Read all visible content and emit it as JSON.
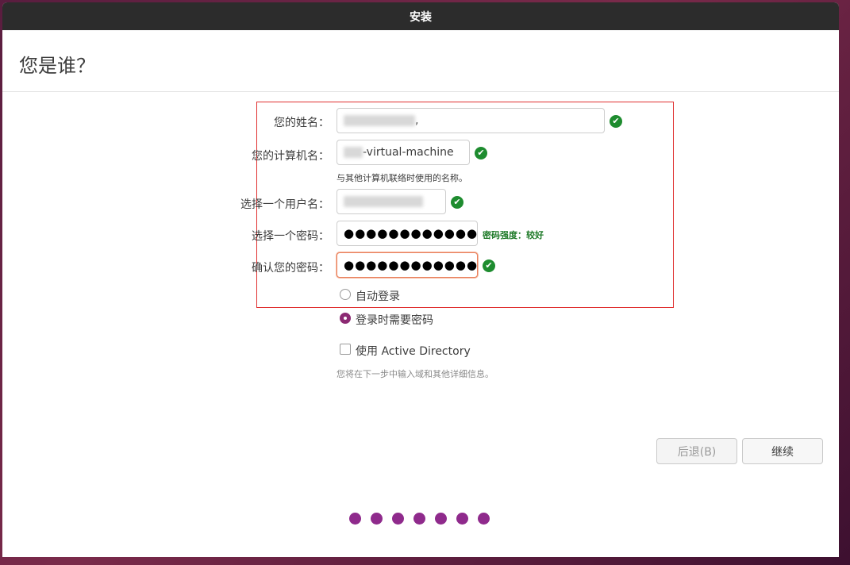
{
  "window": {
    "title": "安装"
  },
  "page": {
    "title": "您是谁？"
  },
  "form": {
    "name": {
      "label": "您的姓名：",
      "value_suffix": ","
    },
    "computer": {
      "label": "您的计算机名：",
      "value_suffix": "-virtual-machine",
      "hint": "与其他计算机联络时使用的名称。"
    },
    "username": {
      "label": "选择一个用户名："
    },
    "password": {
      "label": "选择一个密码：",
      "value": "●●●●●●●●●●●●",
      "strength": "密码强度：较好"
    },
    "confirm": {
      "label": "确认您的密码：",
      "value": "●●●●●●●●●●●●"
    },
    "auto_login": {
      "label": "自动登录",
      "selected": false
    },
    "require_password": {
      "label": "登录时需要密码",
      "selected": true
    },
    "active_directory": {
      "label": "使用 Active Directory",
      "checked": false,
      "hint": "您将在下一步中输入域和其他详细信息。"
    }
  },
  "buttons": {
    "back": "后退(B)",
    "continue": "继续"
  },
  "progress": {
    "total": 7
  },
  "colors": {
    "accent": "#8f2a8c",
    "success": "#1e8c2f",
    "titlebar": "#2c2c2c"
  },
  "icons": {
    "valid": "check-circle-icon"
  }
}
